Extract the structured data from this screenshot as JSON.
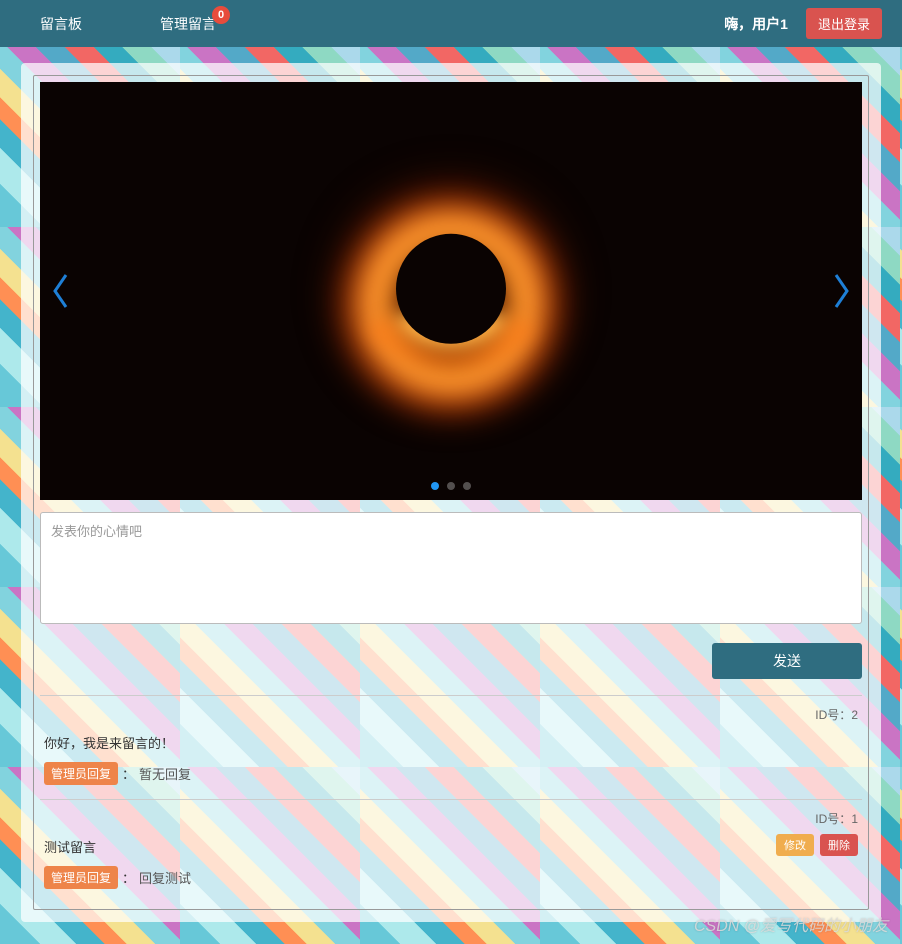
{
  "navbar": {
    "board_label": "留言板",
    "manage_label": "管理留言",
    "badge_count": "0",
    "greeting": "嗨，用户1",
    "logout_label": "退出登录"
  },
  "compose": {
    "placeholder": "发表你的心情吧",
    "send_label": "发送"
  },
  "reply_label_text": "管理员回复",
  "id_prefix": "ID号：",
  "colon": "：",
  "messages": [
    {
      "id": "2",
      "content": "你好，我是来留言的！",
      "reply": "暂无回复",
      "editable": false
    },
    {
      "id": "1",
      "content": "测试留言",
      "reply": "回复测试",
      "editable": true
    }
  ],
  "actions": {
    "edit": "修改",
    "delete": "删除"
  },
  "watermark": "CSDN @爱写代码的小朋友"
}
